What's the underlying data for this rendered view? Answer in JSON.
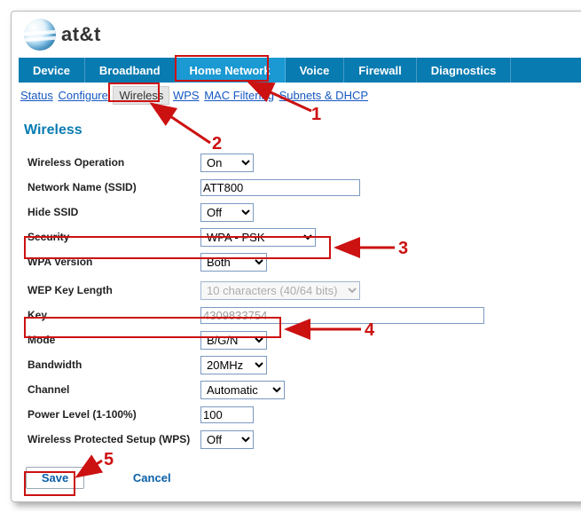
{
  "brand": {
    "name": "at&t"
  },
  "mainnav": {
    "items": [
      {
        "label": "Device"
      },
      {
        "label": "Broadband"
      },
      {
        "label": "Home Network",
        "active": true
      },
      {
        "label": "Voice"
      },
      {
        "label": "Firewall"
      },
      {
        "label": "Diagnostics"
      }
    ]
  },
  "subnav": {
    "status": "Status",
    "configure": "Configure",
    "wireless": "Wireless",
    "wps": "WPS",
    "mac": "MAC Filtering",
    "subnets": "Subnets & DHCP"
  },
  "section": {
    "title": "Wireless"
  },
  "form": {
    "wireless_op": {
      "label": "Wireless Operation",
      "value": "On"
    },
    "ssid": {
      "label": "Network Name (SSID)",
      "value": "ATT800"
    },
    "hide_ssid": {
      "label": "Hide SSID",
      "value": "Off"
    },
    "security": {
      "label": "Security",
      "value": "WPA - PSK"
    },
    "wpa_version": {
      "label": "WPA Version",
      "value": "Both"
    },
    "wep_keylen": {
      "label": "WEP Key Length",
      "value": "10 characters (40/64 bits)"
    },
    "key": {
      "label": "Key",
      "value": "4309833754"
    },
    "mode": {
      "label": "Mode",
      "value": "B/G/N"
    },
    "bandwidth": {
      "label": "Bandwidth",
      "value": "20MHz"
    },
    "channel": {
      "label": "Channel",
      "value": "Automatic"
    },
    "power": {
      "label": "Power Level (1-100%)",
      "value": "100"
    },
    "wps_toggle": {
      "label": "Wireless Protected Setup (WPS)",
      "value": "Off"
    }
  },
  "buttons": {
    "save": "Save",
    "cancel": "Cancel"
  },
  "callouts": {
    "n1": "1",
    "n2": "2",
    "n3": "3",
    "n4": "4",
    "n5": "5"
  }
}
